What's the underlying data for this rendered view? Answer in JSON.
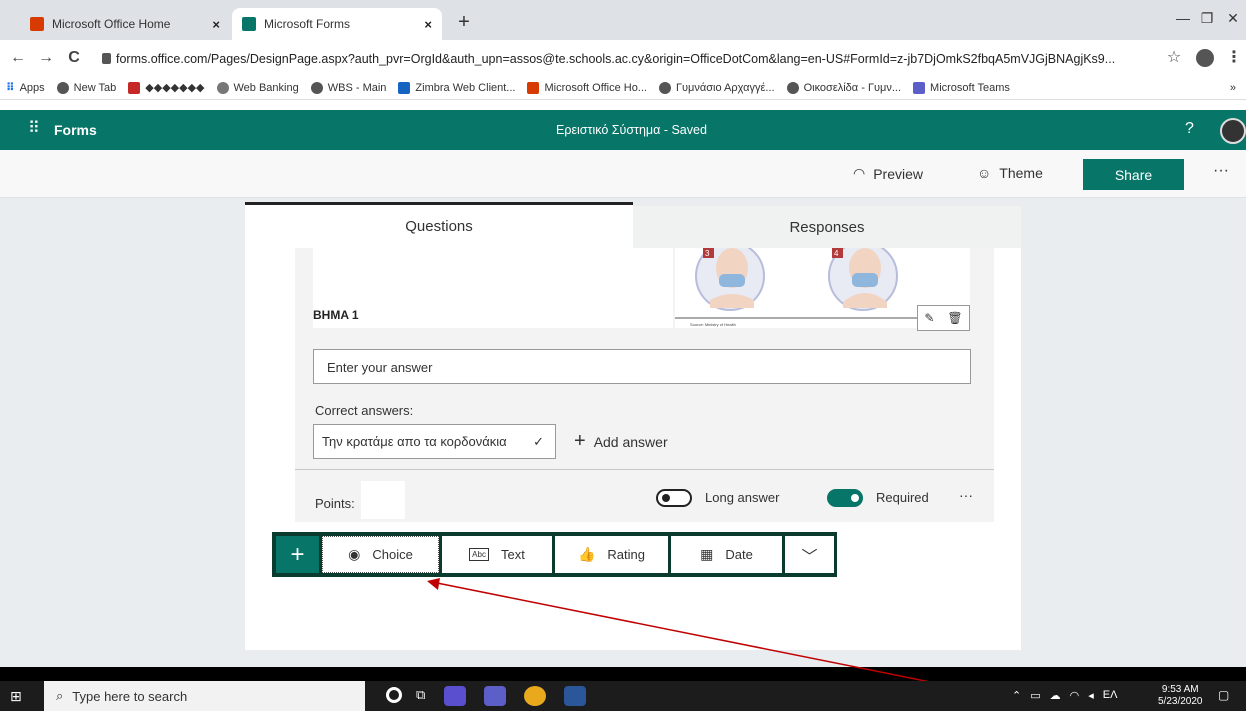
{
  "browser": {
    "tabs": [
      {
        "title": "Microsoft Office Home",
        "close": "×"
      },
      {
        "title": "Microsoft Forms",
        "close": "×"
      }
    ],
    "new_tab": "+",
    "window": {
      "minimize": "—",
      "restore": "❐",
      "close": "✕"
    },
    "url": "forms.office.com/Pages/DesignPage.aspx?auth_pvr=OrgId&auth_upn=assos@te.schools.ac.cy&origin=OfficeDotCom&lang=en-US#FormId=z-jb7DjOmkS2fbqA5mVJGjBNAgjKs9...",
    "bookmarks": [
      "Apps",
      "New Tab",
      "◆◆◆◆◆◆◆",
      "Web Banking",
      "WBS - Main",
      "Zimbra Web Client...",
      "Microsoft Office Ho...",
      "Γυμνάσιο Αρχαγγέ...",
      "Οικοσελίδα - Γυμν...",
      "Microsoft Teams"
    ],
    "bookmarks_more": "»"
  },
  "forms_header": {
    "app_name": "Forms",
    "form_title": "Ερειστικό Σύστημα - Saved",
    "help": "?"
  },
  "command_bar": {
    "preview": "Preview",
    "theme": "Theme",
    "share": "Share",
    "more": "···"
  },
  "tabs": {
    "questions": "Questions",
    "responses": "Responses"
  },
  "question": {
    "title": "BHMA 1",
    "image_steps": [
      "3",
      "4"
    ],
    "image_source": "Source: Ministry of Health",
    "answer_placeholder": "Enter your answer",
    "correct_answers_label": "Correct answers:",
    "correct_answer": "Την κρατάμε απο τα κορδονάκια",
    "add_answer": "Add answer",
    "points_label": "Points:",
    "points_value": "",
    "long_answer": "Long answer",
    "long_answer_on": false,
    "required": "Required",
    "required_on": true,
    "more": "···"
  },
  "add_question": {
    "plus": "+",
    "types": [
      {
        "label": "Choice",
        "icon": "radio-icon"
      },
      {
        "label": "Text",
        "icon": "text-abc-icon"
      },
      {
        "label": "Rating",
        "icon": "thumbs-up-icon"
      },
      {
        "label": "Date",
        "icon": "calendar-icon"
      }
    ],
    "more": "chevron-down-icon"
  },
  "annotation": {
    "color": "#c00000"
  },
  "taskbar": {
    "search_placeholder": "Type here to search",
    "time": "9:53 AM",
    "date": "5/23/2020",
    "language": "EΛ"
  },
  "colors": {
    "forms_green": "#077568",
    "dark_green": "#0b3b2e"
  }
}
